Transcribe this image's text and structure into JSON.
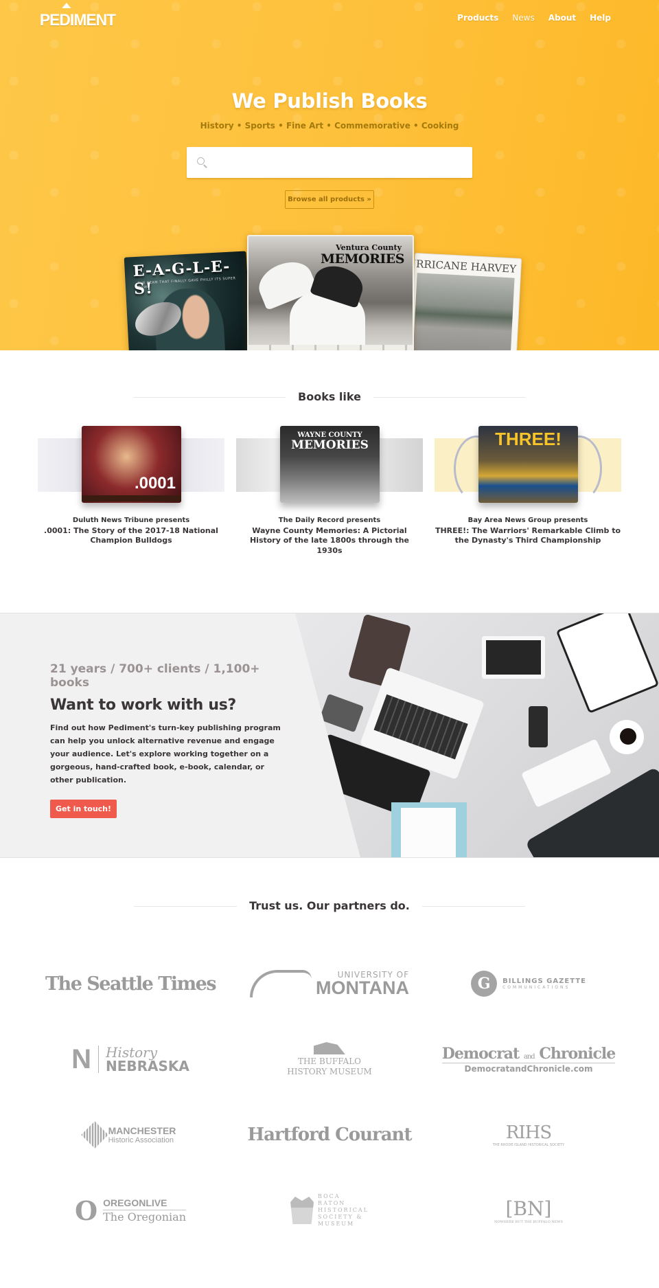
{
  "brand": {
    "name": "PEDIMENT",
    "accent": "#fec13c",
    "cta": "#ef5a4c",
    "text_dark": "#3a3536"
  },
  "nav": {
    "items": [
      {
        "label": "Products"
      },
      {
        "label": "News"
      },
      {
        "label": "About"
      },
      {
        "label": "Help"
      }
    ]
  },
  "hero": {
    "title": "We Publish Books",
    "subtitle": "History • Sports • Fine Art • Commemorative • Cooking",
    "search": {
      "value": "",
      "placeholder": "",
      "icon": "search-icon"
    },
    "browse_label": "Browse all products »",
    "featured_books": [
      {
        "cover_title": "E-A-G-L-E-S!",
        "cover_tagline": "THE TEAM THAT FINALLY GAVE PHILLY ITS SUPER BOWL"
      },
      {
        "cover_supertitle": "Ventura County",
        "cover_title": "MEMORIES"
      },
      {
        "cover_title": "HURRICANE HARVEY"
      }
    ]
  },
  "books_like": {
    "heading": "Books like",
    "items": [
      {
        "cover_label": ".0001",
        "publisher": "Duluth News Tribune presents",
        "title": ".0001: The Story of the 2017-18 National Champion Bulldogs"
      },
      {
        "cover_label_top": "WAYNE COUNTY",
        "cover_label_main": "MEMORIES",
        "publisher": "The Daily Record presents",
        "title": "Wayne County Memories: A Pictorial History of the late 1800s through the 1930s"
      },
      {
        "cover_label": "THREE!",
        "publisher": "Bay Area News Group presents",
        "title": "THREE!: The Warriors' Remarkable Climb to the Dynasty's Third Championship"
      }
    ]
  },
  "work_with_us": {
    "stats": "21 years / 700+ clients / 1,100+ books",
    "title": "Want to work with us?",
    "body": "Find out how Pediment's turn-key publishing program can help you unlock alternative revenue and engage your audience. Let's explore working together on a gorgeous, hand-crafted book, e-book, calendar, or other publication.",
    "cta_label": "Get in touch!"
  },
  "partners": {
    "heading": "Trust us. Our partners do.",
    "logos": {
      "seattle": {
        "name": "The Seattle Times"
      },
      "montana": {
        "top": "UNIVERSITY OF",
        "main": "MONTANA"
      },
      "billings": {
        "badge": "G",
        "name": "BILLINGS GAZETTE",
        "sub": "COMMUNICATIONS"
      },
      "nebraska": {
        "mark": "N",
        "top": "History",
        "main": "NEBRASKA"
      },
      "buffalo": {
        "line1": "THE BUFFALO",
        "line2": "HISTORY MUSEUM"
      },
      "dc": {
        "left": "Democrat",
        "and": "and",
        "right": "Chronicle",
        "url": "DemocratandChronicle.com"
      },
      "manchester": {
        "name": "MANCHESTER",
        "sub": "Historic Association"
      },
      "hartford": {
        "name": "Hartford Courant"
      },
      "rihs": {
        "name": "RIHS",
        "sub": "THE RHODE ISLAND HISTORICAL SOCIETY"
      },
      "oregon": {
        "mark": "O",
        "top": "OREGONLIVE",
        "main": "The Oregonian"
      },
      "boca": {
        "lines": [
          "BOCA",
          "RATON",
          "HISTORICAL",
          "SOCIETY &",
          "MUSEUM"
        ]
      },
      "bn": {
        "mark": "[BN]",
        "sub": "NOWHERE BUT THE BUFFALO NEWS"
      }
    }
  }
}
